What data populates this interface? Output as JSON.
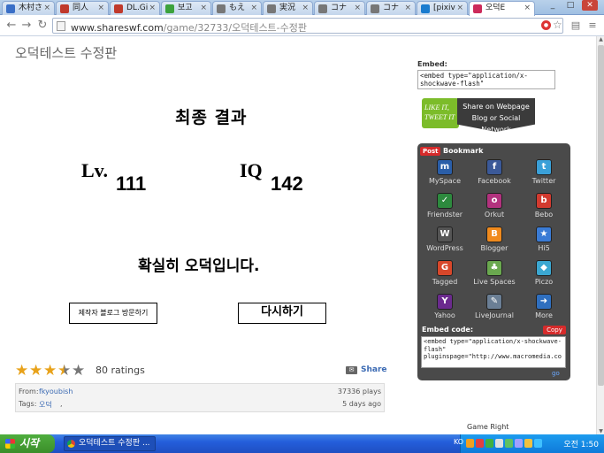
{
  "tabs": [
    {
      "label": "木村さ",
      "fav": "#3a6fc7"
    },
    {
      "label": "同人",
      "fav": "#c0392b"
    },
    {
      "label": "DL.Gi",
      "fav": "#c0392b"
    },
    {
      "label": "보고",
      "fav": "#3ca23c"
    },
    {
      "label": "もえ",
      "fav": "#777"
    },
    {
      "label": "実況",
      "fav": "#777"
    },
    {
      "label": "コナ",
      "fav": "#777"
    },
    {
      "label": "コナ",
      "fav": "#777"
    },
    {
      "label": "[pixiv",
      "fav": "#1a7ccf"
    },
    {
      "label": "오덕E",
      "fav": "#cc2a5a"
    }
  ],
  "toolbar": {
    "url_domain": "www.shareswf.com",
    "url_path": "/game/32733/오덕테스트-수정판"
  },
  "page": {
    "title": "오덕테스트 수정판"
  },
  "game": {
    "heading": "최종 결과",
    "lv_label": "Lv.",
    "lv_value": "111",
    "iq_label": "IQ",
    "iq_value": "142",
    "verdict": "확실히 오덕입니다.",
    "visit_blog_button": "제작자 블로그 방문하기",
    "retry_button": "다시하기"
  },
  "rating": {
    "stars": 3.5,
    "count_text": "80 ratings",
    "share_label": "Share"
  },
  "meta": {
    "from_label": "From:",
    "from_user": "fkyoubish",
    "plays": "37336 plays",
    "tags_label": "Tags:",
    "tag": "오덕",
    "posted": "5 days ago"
  },
  "embed": {
    "label": "Embed:",
    "code_preview": "<embed type=\"application/x-shockwave-flash\"",
    "like_top": "LIKE IT,",
    "like_bottom": "TWEET IT",
    "share_webpage": "Share on Webpage",
    "share_blog": "Blog or Social Network"
  },
  "bookmark_panel": {
    "post_label": "Post",
    "bookmark_label": "Bookmark",
    "items": [
      {
        "label": "MySpace",
        "icon": "myspace-icon",
        "color": "#2a5ea8",
        "glyph": "m"
      },
      {
        "label": "Facebook",
        "icon": "facebook-icon",
        "color": "#3b5998",
        "glyph": "f"
      },
      {
        "label": "Twitter",
        "icon": "twitter-icon",
        "color": "#3aa0d8",
        "glyph": "t"
      },
      {
        "label": "Friendster",
        "icon": "friendster-icon",
        "color": "#2d8a3e",
        "glyph": "✓"
      },
      {
        "label": "Orkut",
        "icon": "orkut-icon",
        "color": "#b2327e",
        "glyph": "o"
      },
      {
        "label": "Bebo",
        "icon": "bebo-icon",
        "color": "#d23a2f",
        "glyph": "b"
      },
      {
        "label": "WordPress",
        "icon": "wordpress-icon",
        "color": "#555",
        "glyph": "W"
      },
      {
        "label": "Blogger",
        "icon": "blogger-icon",
        "color": "#f08a1d",
        "glyph": "B"
      },
      {
        "label": "Hi5",
        "icon": "hi5-icon",
        "color": "#3a7bd5",
        "glyph": "★"
      },
      {
        "label": "Tagged",
        "icon": "tagged-icon",
        "color": "#d8472a",
        "glyph": "G"
      },
      {
        "label": "Live Spaces",
        "icon": "live-spaces-icon",
        "color": "#6aa84f",
        "glyph": "♣"
      },
      {
        "label": "Piczo",
        "icon": "piczo-icon",
        "color": "#3ba7d1",
        "glyph": "◆"
      },
      {
        "label": "Yahoo",
        "icon": "yahoo-icon",
        "color": "#6b2a8e",
        "glyph": "Y"
      },
      {
        "label": "LiveJournal",
        "icon": "livejournal-icon",
        "color": "#6b7f95",
        "glyph": "✎"
      },
      {
        "label": "More",
        "icon": "more-icon",
        "color": "#2f6fbf",
        "glyph": "➜"
      }
    ],
    "embed_code_label": "Embed code:",
    "copy_label": "Copy",
    "embed_code": "<embed type=\"application/x-shockwave-flash\" pluginspage=\"http://www.macromedia.co",
    "go_label": "go"
  },
  "bottom_label": "Game Right",
  "taskbar": {
    "start_label": "시작",
    "task_label": "오덕테스트 수정판 ...",
    "tray_lang": "KO",
    "time": "오전 1:50"
  }
}
